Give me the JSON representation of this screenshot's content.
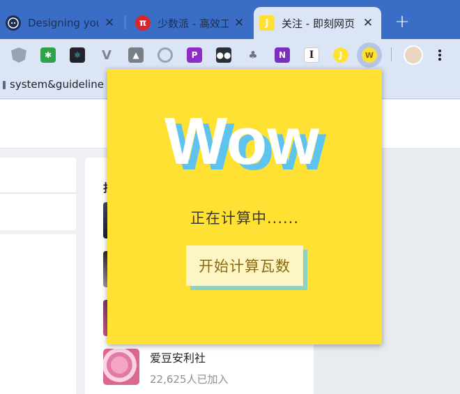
{
  "tabs": [
    {
      "title": "Designing your",
      "icon": "github-octocat-icon",
      "active": false
    },
    {
      "title": "少数派 - 高效工",
      "icon": "sspai-pi-icon",
      "active": false
    },
    {
      "title": "关注 - 即刻网页",
      "icon": "jike-icon",
      "active": true
    }
  ],
  "toolbar": {
    "extensions": [
      "shield-extension-icon",
      "puzzle-green-extension-icon",
      "react-devtools-icon",
      "vue-devtools-icon",
      "image-extension-icon",
      "radar-extension-icon",
      "pdf-purple-extension-icon",
      "owl-extension-icon",
      "tree-extension-icon",
      "onenote-extension-icon",
      "instapaper-icon",
      "jike-extension-icon",
      "wow-extension-icon"
    ]
  },
  "bookmarks": {
    "item": "system&guideline"
  },
  "popup": {
    "logo": "Wow",
    "status": "正在计算中......",
    "button": "开始计算瓦数"
  },
  "page": {
    "heading_partial": "找",
    "club": {
      "name": "爱豆安利社",
      "members": "22,625人已加入"
    }
  }
}
